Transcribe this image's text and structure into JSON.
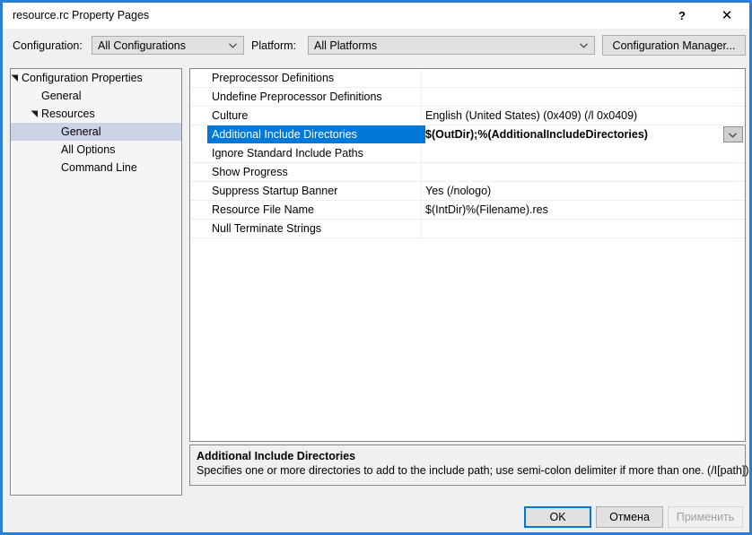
{
  "window": {
    "title": "resource.rc Property Pages",
    "help_button": "?",
    "close_button": "✕",
    "accent_color": "#2a7fd4"
  },
  "config_bar": {
    "configuration_label": "Configuration:",
    "configuration_value": "All Configurations",
    "platform_label": "Platform:",
    "platform_value": "All Platforms",
    "configuration_manager_button": "Configuration Manager..."
  },
  "tree": {
    "items": [
      {
        "label": "Configuration Properties",
        "indent": 0,
        "expander": "expanded",
        "selected": false
      },
      {
        "label": "General",
        "indent": 1,
        "expander": "none",
        "selected": false
      },
      {
        "label": "Resources",
        "indent": 1,
        "expander": "expanded",
        "selected": false
      },
      {
        "label": "General",
        "indent": 2,
        "expander": "none",
        "selected": true
      },
      {
        "label": "All Options",
        "indent": 2,
        "expander": "none",
        "selected": false
      },
      {
        "label": "Command Line",
        "indent": 2,
        "expander": "none",
        "selected": false
      }
    ]
  },
  "grid": {
    "selection_color": "#0078d7",
    "rows": [
      {
        "name": "Preprocessor Definitions",
        "value": "",
        "selected": false
      },
      {
        "name": "Undefine Preprocessor Definitions",
        "value": "",
        "selected": false
      },
      {
        "name": "Culture",
        "value": "English (United States) (0x409) (/l 0x0409)",
        "selected": false
      },
      {
        "name": "Additional Include Directories",
        "value": "$(OutDir);%(AdditionalIncludeDirectories)",
        "selected": true
      },
      {
        "name": "Ignore Standard Include Paths",
        "value": "",
        "selected": false
      },
      {
        "name": "Show Progress",
        "value": "",
        "selected": false
      },
      {
        "name": "Suppress Startup Banner",
        "value": "Yes (/nologo)",
        "selected": false
      },
      {
        "name": "Resource File Name",
        "value": "$(IntDir)%(Filename).res",
        "selected": false
      },
      {
        "name": "Null Terminate Strings",
        "value": "",
        "selected": false
      }
    ]
  },
  "description": {
    "title": "Additional Include Directories",
    "text": "Specifies one or more directories to add to the include path; use semi-colon delimiter if more than one. (/I[path])"
  },
  "footer": {
    "ok_label": "OK",
    "cancel_label": "Отмена",
    "apply_label": "Применить"
  }
}
